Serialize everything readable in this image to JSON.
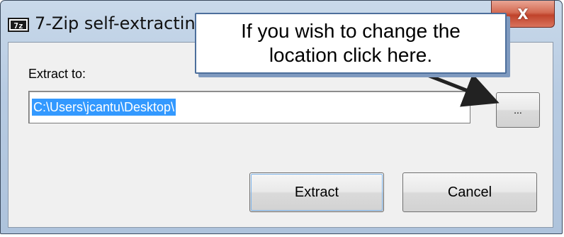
{
  "window": {
    "title": "7-Zip self-extracting",
    "app_icon_text": "7z",
    "close_glyph": "X"
  },
  "form": {
    "extract_label": "Extract to:",
    "path_value": "C:\\Users\\jcantu\\Desktop\\",
    "browse_label": "...",
    "extract_button": "Extract",
    "cancel_button": "Cancel"
  },
  "callout": {
    "text": "If you wish to change the\nlocation click here."
  },
  "colors": {
    "selection": "#3399ff",
    "close_button": "#c0432b",
    "callout_border": "#4d6f9c"
  }
}
